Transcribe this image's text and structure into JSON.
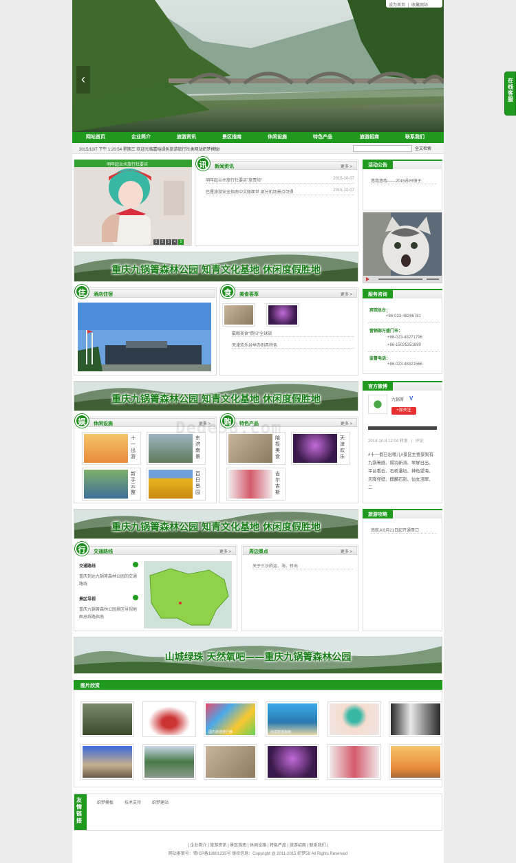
{
  "top_links": {
    "home": "设为首页",
    "separator": "|",
    "favorite": "收藏网站"
  },
  "nav": [
    "网站首页",
    "企业简介",
    "旅游资讯",
    "景区指南",
    "休闲设施",
    "特色产品",
    "旅游招商",
    "联系我们"
  ],
  "ticker": "2015/10/7 下午 1:20:54 星期三 欢迎光临嘉峪绿色旅游旅行社类网站织梦模板!",
  "search": {
    "button": "全文检索"
  },
  "float_service": "在线客服",
  "slide_caption": "明年起兰州旅行社要买",
  "slide_pages": [
    "1",
    "2",
    "3",
    "4",
    "5"
  ],
  "news": {
    "icon": "讯",
    "title": "新闻资讯",
    "more": "更多 >",
    "items": [
      {
        "text": "明年起兰州旅行社要买\"旅责险\"",
        "date": "2015-10-07"
      },
      {
        "text": "巴厘旅游安全指南中文版面世 部分机场景点可得",
        "date": "2015-10-07"
      }
    ]
  },
  "activity": {
    "title": "活动公告",
    "items": [
      "悠哉悠哉——2015苏州镜子"
    ]
  },
  "banner": "重庆九锅箐森林公园 知青文化基地 休闲度假胜地",
  "hotel": {
    "icon": "住",
    "title": "酒店住宿"
  },
  "food": {
    "icon": "食",
    "title": "美食荟萃",
    "more": "更多 >",
    "items": [
      "戴眼美食\"攒扫\"全球旅",
      "天津欢乐谷举办别具特色"
    ]
  },
  "service": {
    "title": "服务咨询",
    "groups": [
      {
        "label": "宾馆总台：",
        "phones": [
          "+86-023-48266781"
        ]
      },
      {
        "label": "营销部万盛门市：",
        "phones": [
          "+86-023-48271796",
          "+86-15025351889"
        ]
      },
      {
        "label": "监督电话：",
        "phones": [
          "+86-023-48321566"
        ]
      }
    ]
  },
  "leisure": {
    "icon": "娱",
    "title": "休闲设施",
    "more": "更多 >",
    "items": [
      "十一出游",
      "东济南景",
      "新手云整",
      "百日景园"
    ]
  },
  "products": {
    "icon": "购",
    "title": "特色产品",
    "more": "更多 >",
    "items": [
      "陪揽美食",
      "天津欢乐",
      "吉尔吉斯"
    ]
  },
  "weibo": {
    "title": "官方微博",
    "name": "九锅箐",
    "verified": "V",
    "follow": "+加关注",
    "meta": "2014-10-8 12:04 转发",
    "meta_sep": "|",
    "comment": "评论",
    "text": "#十一假日出哪儿#景区主要景观有九锅箐感、隔羽新涛、翠屏日出、平台看云、石桥瀑坛、神龟望海、天降怪壁、麒麟石刻、仙女泪翠、二"
  },
  "watermark": "Dede58.com",
  "transport": {
    "icon": "行",
    "title": "交通路线",
    "more": "更多 >",
    "routes": [
      {
        "title": "交通路线",
        "desc": "重庆到达九锅箐森林公园的交通路线"
      },
      {
        "title": "景区导视",
        "desc": "重庆九锅箐森林公园景区导视地图总线路指南"
      }
    ]
  },
  "nearby": {
    "title": "周边景点",
    "more": "更多 >",
    "items": [
      "关于三沙的运、海、日出"
    ]
  },
  "guide": {
    "title": "旅游攻略",
    "items": [
      "南航从6月21日起开通哥口"
    ]
  },
  "banner2": "山城绿珠  天然氧吧——重庆九锅箐森林公园",
  "gallery": {
    "title": "图片欣赏",
    "captions": {
      "p9": "国内旅游排行榜",
      "p10": "出境旅游指南"
    }
  },
  "links": {
    "title": "友情链接",
    "items": [
      "织梦模板",
      "技术支持",
      "织梦建站"
    ]
  },
  "footer": {
    "nav": [
      "企业简介",
      "旅游资讯",
      "景区指南",
      "休闲设施",
      "特色产品",
      "旅游招商",
      "联系我们"
    ],
    "copyright": "网站备案号：粤ICP备18801235号  版权信息：Copyright @ 2011-2015 织梦58 All Rights Reserved"
  },
  "colors": {
    "accent": "#1f9a1f",
    "accent_dark": "#1a7f1a",
    "follow": "#e83030"
  }
}
